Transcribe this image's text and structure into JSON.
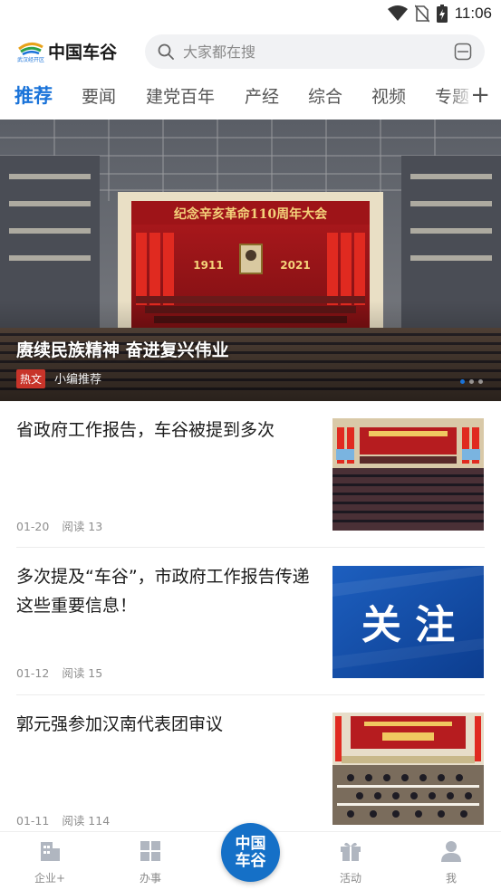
{
  "status": {
    "time": "11:06"
  },
  "header": {
    "logo_text": "中国车谷",
    "logo_small": "武汉经开区",
    "search_placeholder": "大家都在搜"
  },
  "tabs": [
    {
      "label": "推荐",
      "active": true
    },
    {
      "label": "要闻"
    },
    {
      "label": "建党百年"
    },
    {
      "label": "产经"
    },
    {
      "label": "综合"
    },
    {
      "label": "视频"
    },
    {
      "label": "专题"
    }
  ],
  "hero": {
    "banner_text": "纪念辛亥革命110周年大会",
    "year_left": "1911",
    "year_right": "2021",
    "title": "赓续民族精神 奋进复兴伟业",
    "tag": "热文",
    "subtitle": "小编推荐",
    "slides": 3,
    "active_slide": 1
  },
  "news": [
    {
      "title": "省政府工作报告，车谷被提到多次",
      "date": "01-20",
      "reads": "阅读 13",
      "thumb": "meeting"
    },
    {
      "title": "多次提及“车谷”，市政府工作报告传递这些重要信息！",
      "date": "01-12",
      "reads": "阅读 15",
      "thumb": "attention",
      "thumb_text": "关 注"
    },
    {
      "title": "郭元强参加汉南代表团审议",
      "date": "01-11",
      "reads": "阅读 114",
      "thumb": "delegation"
    }
  ],
  "bottom_nav": {
    "items": [
      {
        "label": "企业+",
        "icon": "enterprise-icon"
      },
      {
        "label": "办事",
        "icon": "grid-icon"
      },
      {
        "label": "活动",
        "icon": "gift-icon"
      },
      {
        "label": "我",
        "icon": "user-icon"
      }
    ],
    "center_line1": "中国",
    "center_line2": "车谷"
  },
  "colors": {
    "accent": "#1a73d9",
    "tag_red": "#c8342a",
    "center_button": "#1570c7"
  }
}
